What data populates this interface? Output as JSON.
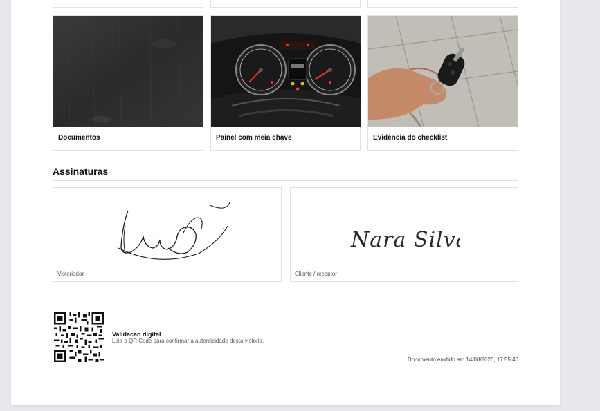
{
  "photos": [
    {
      "caption": "Documentos",
      "subject": "dark-textured-mat"
    },
    {
      "caption": "Painel com meia chave",
      "subject": "instrument-cluster"
    },
    {
      "caption": "Evidência do checklist",
      "subject": "hand-holding-car-key"
    }
  ],
  "signatures": {
    "title": "Assinaturas",
    "inspector_label": "Vistoriador",
    "client_label": "Cliente / receptor",
    "client_signature_text": "Nara Silva"
  },
  "validation": {
    "title": "Validacao digital",
    "description": "Leia o QR Code para confirmar a autenticidade desta vistoria.",
    "emitted": "Documento emitido em 14/08/2026, 17:55:46"
  },
  "colors": {
    "page_bg": "#e6e8eb",
    "card_border": "#dfe1e4"
  }
}
